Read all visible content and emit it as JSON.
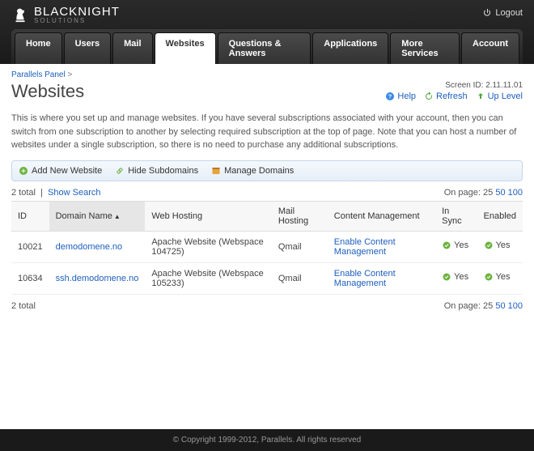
{
  "brand": {
    "name": "BLACKNIGHT",
    "sub": "SOLUTIONS"
  },
  "logout": "Logout",
  "nav": [
    {
      "label": "Home",
      "active": false
    },
    {
      "label": "Users",
      "active": false
    },
    {
      "label": "Mail",
      "active": false
    },
    {
      "label": "Websites",
      "active": true
    },
    {
      "label": "Questions & Answers",
      "active": false
    },
    {
      "label": "Applications",
      "active": false
    },
    {
      "label": "More Services",
      "active": false
    },
    {
      "label": "Account",
      "active": false
    }
  ],
  "breadcrumb": {
    "root": "Parallels Panel",
    "sep": ">"
  },
  "page_title": "Websites",
  "screen_id_label": "Screen ID:",
  "screen_id": "2.11.11.01",
  "toplinks": {
    "help": "Help",
    "refresh": "Refresh",
    "uplevel": "Up Level"
  },
  "description": "This is where you set up and manage websites. If you have several subscriptions associated with your account, then you can switch from one subscription to another by selecting required subscription at the top of page. Note that you can host a number of websites under a single subscription, so there is no need to purchase any additional subscriptions.",
  "toolbar": {
    "add": "Add New Website",
    "hide": "Hide Subdomains",
    "manage": "Manage Domains"
  },
  "total_label": "2 total",
  "show_search": "Show Search",
  "onpage_label": "On page:",
  "onpage_current": "25",
  "onpage_options": [
    "50",
    "100"
  ],
  "columns": {
    "id": "ID",
    "domain": "Domain Name",
    "webhosting": "Web Hosting",
    "mailhosting": "Mail Hosting",
    "content": "Content Management",
    "insync": "In Sync",
    "enabled": "Enabled"
  },
  "rows": [
    {
      "id": "10021",
      "domain": "demodomene.no",
      "webhosting": "Apache Website (Webspace 104725)",
      "mailhosting": "Qmail",
      "content": "Enable Content Management",
      "insync": "Yes",
      "enabled": "Yes"
    },
    {
      "id": "10634",
      "domain": "ssh.demodomene.no",
      "webhosting": "Apache Website (Webspace 105233)",
      "mailhosting": "Qmail",
      "content": "Enable Content Management",
      "insync": "Yes",
      "enabled": "Yes"
    }
  ],
  "footer": "© Copyright 1999-2012, Parallels. All rights reserved"
}
